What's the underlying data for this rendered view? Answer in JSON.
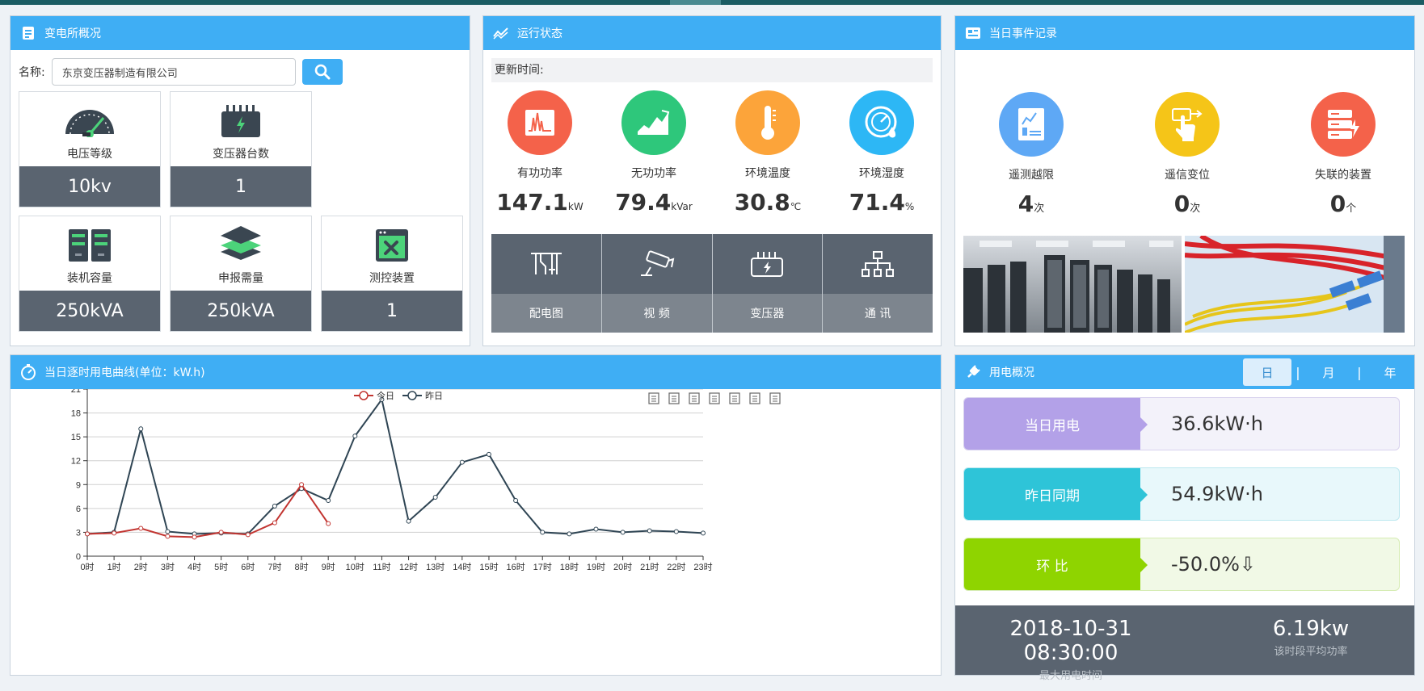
{
  "overview": {
    "title": "变电所概况",
    "name_label": "名称:",
    "name_value": "东京变压器制造有限公司",
    "cards": [
      {
        "label": "电压等级",
        "value": "10kv",
        "icon": "gauge-icon"
      },
      {
        "label": "变压器台数",
        "value": "1",
        "icon": "transformer-icon"
      },
      {
        "label": "装机容量",
        "value": "250kVA",
        "icon": "server-icon"
      },
      {
        "label": "申报需量",
        "value": "250kVA",
        "icon": "layers-icon"
      },
      {
        "label": "测控装置",
        "value": "1",
        "icon": "monitor-device-icon"
      }
    ]
  },
  "status": {
    "title": "运行状态",
    "update_label": "更新时间:",
    "items": [
      {
        "label": "有功功率",
        "value": "147.1",
        "unit": "kW",
        "color": "#f4624a"
      },
      {
        "label": "无功功率",
        "value": "79.4",
        "unit": "kVar",
        "color": "#2ec77b"
      },
      {
        "label": "环境温度",
        "value": "30.8",
        "unit": "℃",
        "color": "#fca43a"
      },
      {
        "label": "环境湿度",
        "value": "71.4",
        "unit": "%",
        "color": "#2db7f5"
      }
    ],
    "tools": [
      {
        "label": "配电图",
        "icon": "distribution-diagram-icon"
      },
      {
        "label": "视 频",
        "icon": "camera-icon"
      },
      {
        "label": "变压器",
        "icon": "transformer-icon"
      },
      {
        "label": "通 讯",
        "icon": "network-icon"
      }
    ]
  },
  "events": {
    "title": "当日事件记录",
    "items": [
      {
        "label": "遥测越限",
        "value": "4",
        "unit": "次",
        "color": "#5ea8f5"
      },
      {
        "label": "遥信变位",
        "value": "0",
        "unit": "次",
        "color": "#f5c518"
      },
      {
        "label": "失联的装置",
        "value": "0",
        "unit": "个",
        "color": "#f4624a"
      }
    ]
  },
  "curve": {
    "title": "当日逐时用电曲线(单位：kW.h)"
  },
  "chart_data": {
    "type": "line",
    "title": "",
    "x": [
      "0时",
      "1时",
      "2时",
      "3时",
      "4时",
      "5时",
      "6时",
      "7时",
      "8时",
      "9时",
      "10时",
      "11时",
      "12时",
      "13时",
      "14时",
      "15时",
      "16时",
      "17时",
      "18时",
      "19时",
      "20时",
      "21时",
      "22时",
      "23时"
    ],
    "ylim": [
      0,
      21
    ],
    "yticks": [
      0,
      3,
      6,
      9,
      12,
      15,
      18,
      21
    ],
    "grid": true,
    "legend_position": "top-center",
    "series": [
      {
        "name": "今日",
        "color": "#c23531",
        "values": [
          2.8,
          2.9,
          3.5,
          2.5,
          2.4,
          3.0,
          2.7,
          4.2,
          9.0,
          4.1
        ]
      },
      {
        "name": "昨日",
        "color": "#2f4554",
        "values": [
          2.8,
          3.0,
          16.0,
          3.1,
          2.8,
          2.9,
          2.8,
          6.3,
          8.5,
          7.0,
          15.1,
          19.7,
          4.4,
          7.4,
          11.8,
          12.8,
          7.0,
          3.0,
          2.8,
          3.4,
          3.0,
          3.2,
          3.1,
          2.9
        ]
      }
    ],
    "toolbox": [
      "data-view-icon",
      "line-switch-icon",
      "bar-switch-icon",
      "stack-icon",
      "tiled-icon",
      "restore-icon",
      "save-image-icon"
    ]
  },
  "usage": {
    "title": "用电概况",
    "tabs": [
      "日",
      "月",
      "年"
    ],
    "separator": "|",
    "rows": [
      {
        "label": "当日用电",
        "value": "36.6kW·h",
        "color": "#b3a1e8",
        "bg": "#f3f2fa",
        "border": "#d8d2ee"
      },
      {
        "label": "昨日同期",
        "value": "54.9kW·h",
        "color": "#2ec4d8",
        "bg": "#e8f8fb",
        "border": "#bde8ef"
      },
      {
        "label": "环 比",
        "value": "-50.0%⇩",
        "color": "#8fd400",
        "bg": "#f1f9e6",
        "border": "#d6ecb4"
      }
    ],
    "max_time": "2018-10-31 08:30:00",
    "max_time_caption": "最大用电时间",
    "avg_power": "6.19kw",
    "avg_power_caption": "该时段平均功率"
  }
}
